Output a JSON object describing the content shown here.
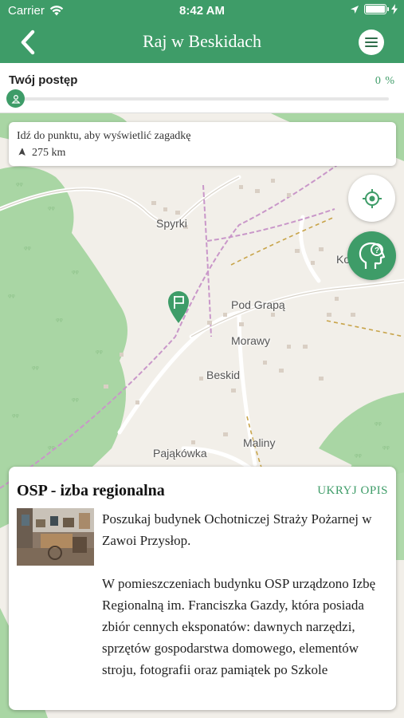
{
  "status_bar": {
    "carrier": "Carrier",
    "time": "8:42 AM"
  },
  "header": {
    "title": "Raj w Beskidach",
    "back_icon": "chevron-left-icon",
    "menu_icon": "menu-icon"
  },
  "progress": {
    "label": "Twój postęp",
    "value_text": "0 %",
    "fraction": 0
  },
  "hint": {
    "text": "Idź do punktu, aby wyświetlić zagadkę",
    "distance": "275 km"
  },
  "map": {
    "labels": {
      "spyrki": "Spyrki",
      "pod_grapa": "Pod Grapą",
      "morawy": "Morawy",
      "beskid": "Beskid",
      "maliny": "Maliny",
      "pajakowka": "Pająkówka",
      "ko": "Ko"
    }
  },
  "info": {
    "title": "OSP - izba regionalna",
    "hide_label": "UKRYJ OPIS",
    "text": "Poszukaj budynek Ochotniczej Straży Pożarnej w Zawoi Przysłop.\n\nW pomieszczeniach budynku OSP urządzono Izbę Regionalną im. Franciszka Gazdy, która posiada zbiór cennych eksponatów: dawnych narzędzi, sprzętów gospodarstwa domowego, elementów stroju, fotografii oraz pamiątek po Szkole"
  },
  "colors": {
    "accent": "#3e9c68",
    "map_background": "#f2efe9",
    "forest": "#a9d6a4"
  }
}
